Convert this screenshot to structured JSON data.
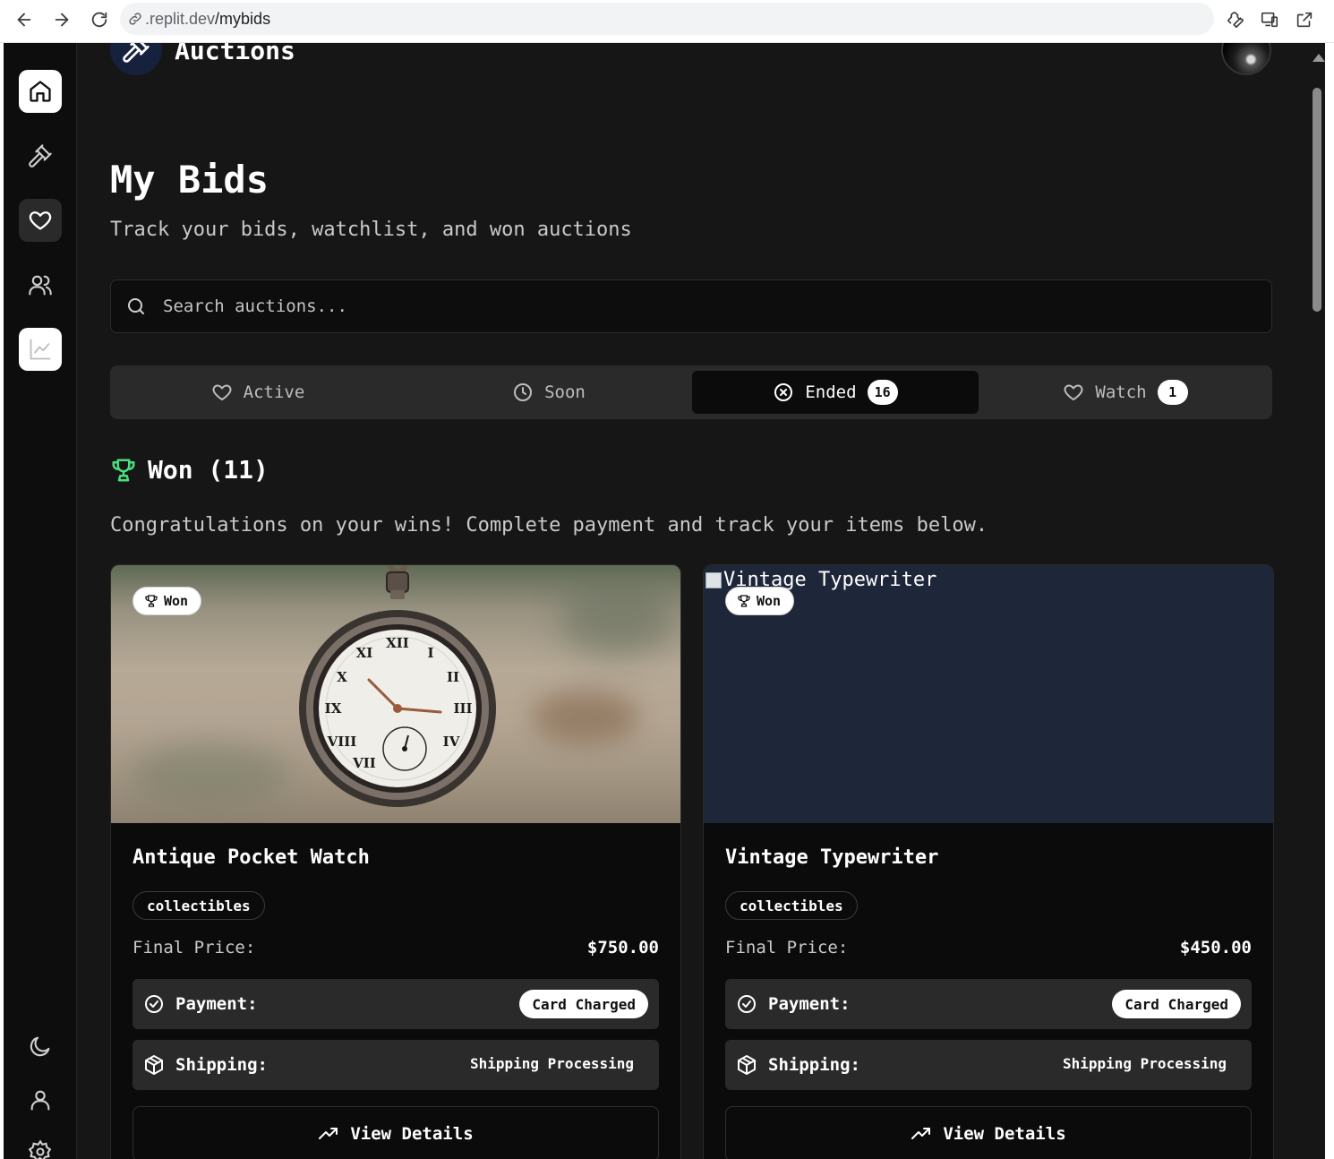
{
  "browser": {
    "url_host": ".replit.dev",
    "url_path": "/mybids"
  },
  "header": {
    "brand": "Auctions"
  },
  "page": {
    "title": "My Bids",
    "subtitle": "Track your bids, watchlist, and won auctions"
  },
  "search": {
    "placeholder": "Search auctions..."
  },
  "tabs": [
    {
      "label": "Active",
      "icon": "heart-icon",
      "count": null,
      "active": false
    },
    {
      "label": "Soon",
      "icon": "clock-icon",
      "count": null,
      "active": false
    },
    {
      "label": "Ended",
      "icon": "x-circle-icon",
      "count": "16",
      "active": true
    },
    {
      "label": "Watch",
      "icon": "heart-icon",
      "count": "1",
      "active": false
    }
  ],
  "won_section": {
    "heading": "Won (11)",
    "message": "Congratulations on your wins! Complete payment and track your items below."
  },
  "cards": [
    {
      "badge": "Won",
      "image_alt": "",
      "title": "Antique Pocket Watch",
      "category": "collectibles",
      "price_label": "Final Price:",
      "price": "$750.00",
      "payment_label": "Payment:",
      "payment_status": "Card Charged",
      "shipping_label": "Shipping:",
      "shipping_status": "Shipping Processing",
      "details_label": "View Details"
    },
    {
      "badge": "Won",
      "image_alt": "Vintage Typewriter",
      "title": "Vintage Typewriter",
      "category": "collectibles",
      "price_label": "Final Price:",
      "price": "$450.00",
      "payment_label": "Payment:",
      "payment_status": "Card Charged",
      "shipping_label": "Shipping:",
      "shipping_status": "Shipping Processing",
      "details_label": "View Details"
    }
  ],
  "colors": {
    "background": "#161616",
    "sidebar": "#0d0d0e",
    "accent_green": "#4ade80",
    "logo_bg": "#16223d"
  }
}
